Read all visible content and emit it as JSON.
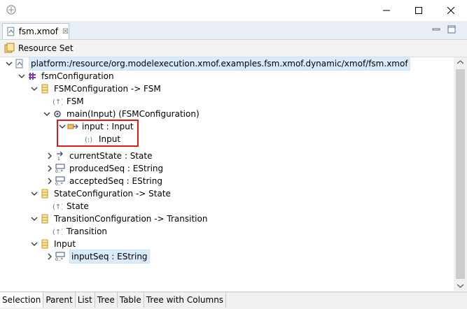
{
  "window": {
    "title": ""
  },
  "editor_tab": {
    "label": "fsm.xmof",
    "close_glyph": "☒"
  },
  "resource_set": {
    "label": "Resource Set"
  },
  "tree": [
    {
      "label": "platform:/resource/org.modelexecution.xmof.examples.fsm.xmof.dynamic/xmof/fsm.xmof",
      "icon": "file-icon",
      "expanded": true
    },
    {
      "label": "fsmConfiguration",
      "icon": "package-icon",
      "expanded": true
    },
    {
      "label": "FSMConfiguration -> FSM",
      "icon": "class-icon",
      "expanded": true
    },
    {
      "label": "FSM",
      "icon": "supertype-icon"
    },
    {
      "label": "main(Input) (FSMConfiguration)",
      "icon": "operation-icon",
      "expanded": true
    },
    {
      "label": "input : Input",
      "icon": "parameter-icon",
      "expanded": true
    },
    {
      "label": "Input",
      "icon": "type-icon"
    },
    {
      "label": "currentState : State",
      "icon": "reference-icon",
      "expanded": false
    },
    {
      "label": "producedSeq : EString",
      "icon": "attribute-icon",
      "expanded": false
    },
    {
      "label": "acceptedSeq : EString",
      "icon": "attribute-icon",
      "expanded": false
    },
    {
      "label": "StateConfiguration -> State",
      "icon": "class-icon",
      "expanded": true
    },
    {
      "label": "State",
      "icon": "supertype-icon"
    },
    {
      "label": "TransitionConfiguration -> Transition",
      "icon": "class-icon",
      "expanded": true
    },
    {
      "label": "Transition",
      "icon": "supertype-icon"
    },
    {
      "label": "Input",
      "icon": "class-icon",
      "expanded": true
    },
    {
      "label": "inputSeq : EString",
      "icon": "attribute-icon",
      "expanded": false,
      "selected": true
    }
  ],
  "bottom_tabs": [
    "Selection",
    "Parent",
    "List",
    "Tree",
    "Table",
    "Tree with Columns"
  ],
  "colors": {
    "highlight": "#e01a1a",
    "selection": "#d9ebfb",
    "class": "#c8962a",
    "package": "#8a3aa8"
  }
}
